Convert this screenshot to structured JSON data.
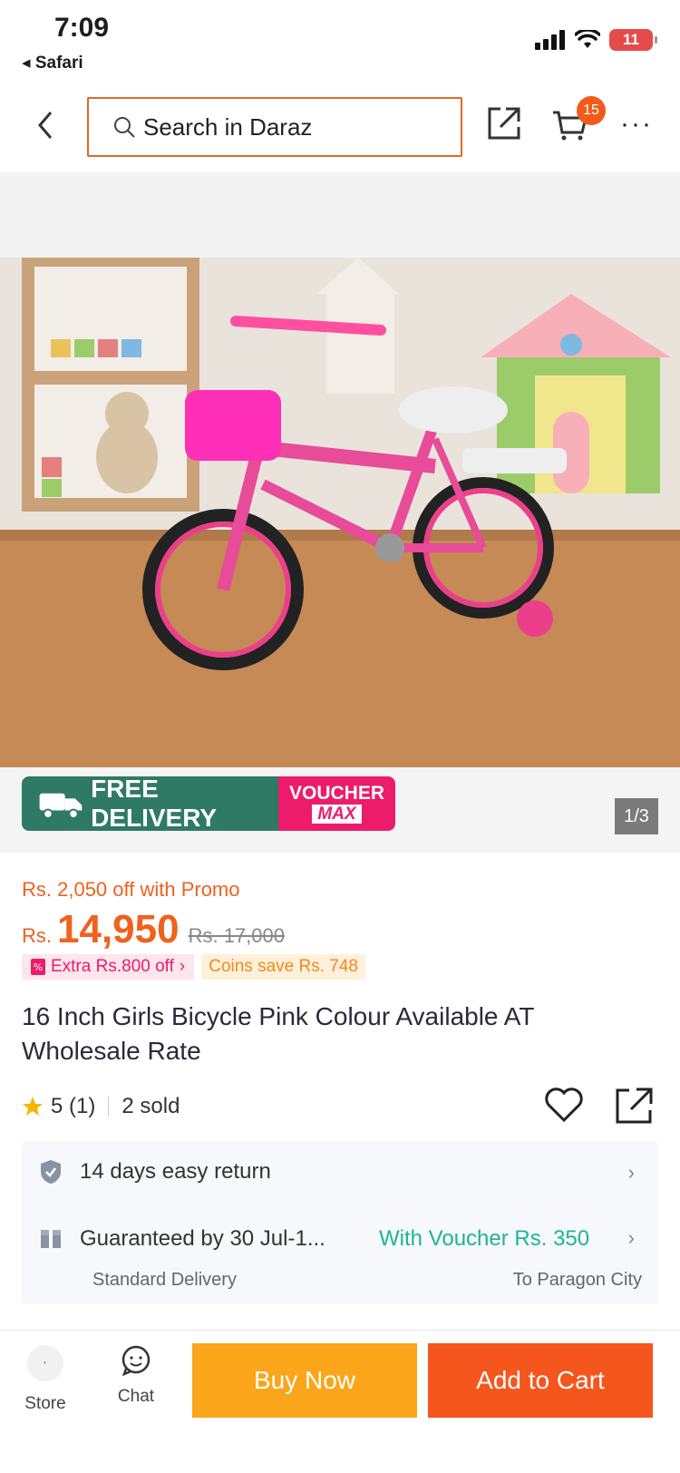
{
  "status_bar": {
    "time": "7:09",
    "back_app": "Safari",
    "battery": "11"
  },
  "header": {
    "search_placeholder": "Search in Daraz",
    "cart_count": "15"
  },
  "gallery": {
    "free_delivery": "FREE DELIVERY",
    "voucher_line1": "VOUCHER",
    "voucher_line2": "MAX",
    "pager": "1/3"
  },
  "pricing": {
    "promo_off": "Rs. 2,050 off with Promo",
    "currency": "Rs.",
    "price": "14,950",
    "old_price": "Rs. 17,000",
    "extra_off": "Extra Rs.800 off",
    "coins_save": "Coins save Rs. 748"
  },
  "product": {
    "title": "16 Inch Girls Bicycle Pink Colour Available AT Wholesale Rate",
    "rating": "5",
    "rating_count": "(1)",
    "sold": "2 sold"
  },
  "service": {
    "return": "14 days easy return",
    "delivery": "Guaranteed by 30 Jul-1...",
    "voucher": "With Voucher Rs. 350",
    "standard": "Standard Delivery",
    "destination": "To Paragon City"
  },
  "bottom": {
    "store": "Store",
    "chat": "Chat",
    "buy_now": "Buy Now",
    "add_to_cart": "Add to Cart"
  },
  "colors": {
    "accent": "#f5561e",
    "buy": "#faa51a",
    "free_delivery": "#2f7a64",
    "voucher": "#ec1c6b",
    "teal": "#1eb39a"
  }
}
